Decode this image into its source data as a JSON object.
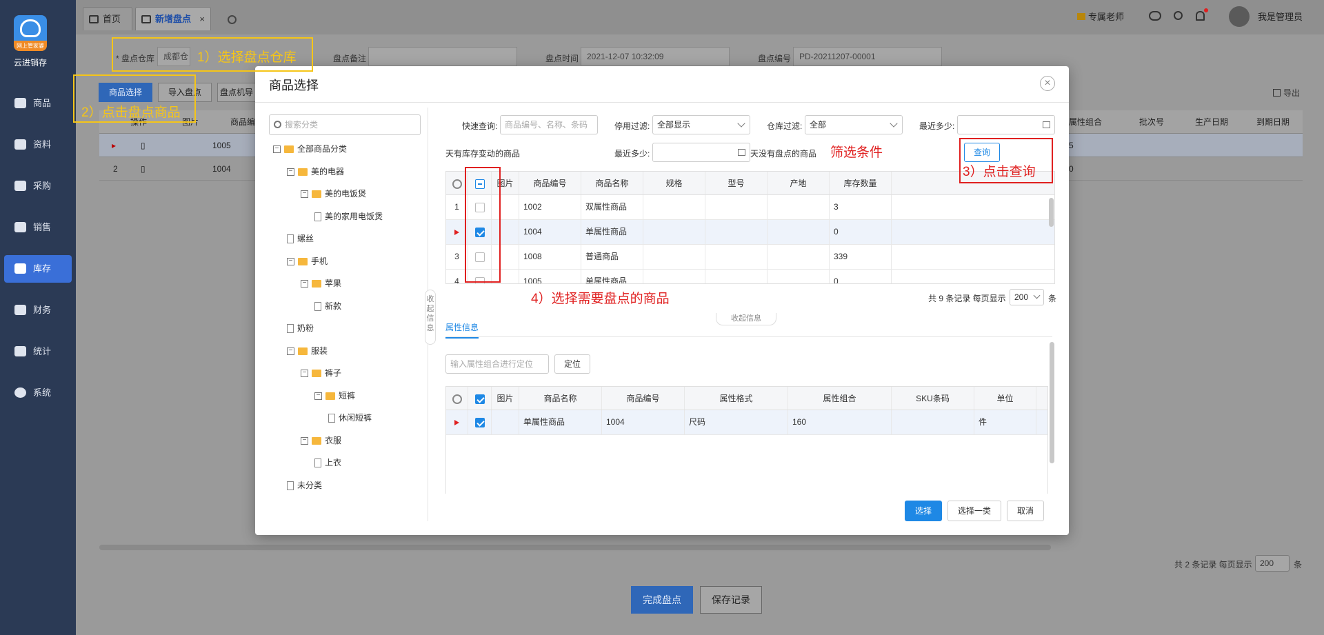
{
  "app": {
    "name": "云进销存",
    "logo_text": "网上管家婆"
  },
  "sidebar": {
    "items": [
      {
        "label": "商品",
        "icon": "bag-icon"
      },
      {
        "label": "资料",
        "icon": "profile-icon"
      },
      {
        "label": "采购",
        "icon": "purchase-icon"
      },
      {
        "label": "销售",
        "icon": "chart-icon"
      },
      {
        "label": "库存",
        "icon": "warehouse-icon",
        "active": true
      },
      {
        "label": "财务",
        "icon": "finance-icon"
      },
      {
        "label": "统计",
        "icon": "stats-icon"
      },
      {
        "label": "系统",
        "icon": "settings-icon"
      }
    ]
  },
  "header": {
    "tabs": [
      {
        "label": "首页",
        "icon": "home-icon"
      },
      {
        "label": "新增盘点",
        "icon": "calendar-icon",
        "active": true,
        "close": "×"
      }
    ],
    "right": {
      "vip": "专属老师",
      "user": "我是管理员"
    }
  },
  "page": {
    "warehouse_label": "* 盘点仓库",
    "warehouse_value": "成都仓",
    "remark_label": "盘点备注",
    "time_label": "盘点时间",
    "time_value": "2021-12-07 10:32:09",
    "code_label": "盘点编号",
    "code_value": "PD-20211207-00001",
    "buttons": {
      "select_goods": "商品选择",
      "import": "导入盘点",
      "machine": "盘点机导入"
    },
    "export": "导出",
    "table": {
      "headers": [
        "操作",
        "图片",
        "商品编号",
        "属性组合",
        "批次号",
        "生产日期",
        "到期日期"
      ],
      "rows": [
        {
          "no": "1",
          "code": "1005",
          "attr": "5"
        },
        {
          "no": "2",
          "code": "1004",
          "attr": "0"
        }
      ]
    },
    "pager": {
      "text": "共 2 条记录  每页显示",
      "size": "200",
      "unit": "条"
    },
    "footer": {
      "finish": "完成盘点",
      "save": "保存记录"
    }
  },
  "annotations": {
    "step1": "1）选择盘点仓库",
    "step2": "2）点击盘点商品",
    "filter": "筛选条件",
    "step3": "3）点击查询",
    "step4": "4）选择需要盘点的商品"
  },
  "modal": {
    "title": "商品选择",
    "close": "×",
    "tree": {
      "search_placeholder": "搜索分类",
      "nodes": [
        {
          "label": "全部商品分类",
          "type": "folder",
          "level": 0
        },
        {
          "label": "美的电器",
          "type": "folder",
          "level": 1
        },
        {
          "label": "美的电饭煲",
          "type": "folder",
          "level": 2
        },
        {
          "label": "美的家用电饭煲",
          "type": "file",
          "level": 3
        },
        {
          "label": "螺丝",
          "type": "file",
          "level": 1
        },
        {
          "label": "手机",
          "type": "folder",
          "level": 1
        },
        {
          "label": "苹果",
          "type": "folder",
          "level": 2
        },
        {
          "label": "新款",
          "type": "file",
          "level": 3
        },
        {
          "label": "奶粉",
          "type": "file",
          "level": 1
        },
        {
          "label": "服装",
          "type": "folder",
          "level": 1
        },
        {
          "label": "裤子",
          "type": "folder",
          "level": 2
        },
        {
          "label": "短裤",
          "type": "folder",
          "level": 3
        },
        {
          "label": "休闲短裤",
          "type": "file",
          "level": 4
        },
        {
          "label": "衣服",
          "type": "folder",
          "level": 2
        },
        {
          "label": "上衣",
          "type": "file",
          "level": 3
        },
        {
          "label": "未分类",
          "type": "file",
          "level": 1
        }
      ],
      "collapse_label": "收起信息"
    },
    "filters": {
      "quick_label": "快速查询:",
      "quick_placeholder": "商品编号、名称、条码",
      "disable_label": "停用过滤:",
      "disable_value": "全部显示",
      "wh_label": "仓库过滤:",
      "wh_value": "全部",
      "recent_label": "最近多少:",
      "recent_suffix": "天有库存变动的商品",
      "recent2_label": "最近多少:",
      "recent2_suffix": "天没有盘点的商品",
      "query": "查询"
    },
    "goods_table": {
      "headers": [
        "图片",
        "商品编号",
        "商品名称",
        "规格",
        "型号",
        "产地",
        "库存数量"
      ],
      "rows": [
        {
          "no": "1",
          "checked": false,
          "code": "1002",
          "name": "双属性商品",
          "stock": "3"
        },
        {
          "no": "",
          "checked": true,
          "code": "1004",
          "name": "单属性商品",
          "stock": "0",
          "current": true
        },
        {
          "no": "3",
          "checked": false,
          "code": "1008",
          "name": "普通商品",
          "stock": "339"
        },
        {
          "no": "4",
          "checked": false,
          "code": "1005",
          "name": "单属性商品",
          "stock": "0"
        }
      ],
      "pager_text": "共 9 条记录  每页显示",
      "pager_size": "200",
      "pager_unit": "条"
    },
    "collapse_info": "收起信息",
    "attr": {
      "tab": "属性信息",
      "locate_placeholder": "输入属性组合进行定位",
      "locate_button": "定位",
      "headers": [
        "图片",
        "商品名称",
        "商品编号",
        "属性格式",
        "属性组合",
        "SKU条码",
        "单位"
      ],
      "rows": [
        {
          "name": "单属性商品",
          "code": "1004",
          "format": "尺码",
          "combo": "160",
          "sku": "",
          "unit": "件"
        }
      ]
    },
    "buttons": {
      "select": "选择",
      "select_class": "选择一类",
      "cancel": "取消"
    }
  }
}
